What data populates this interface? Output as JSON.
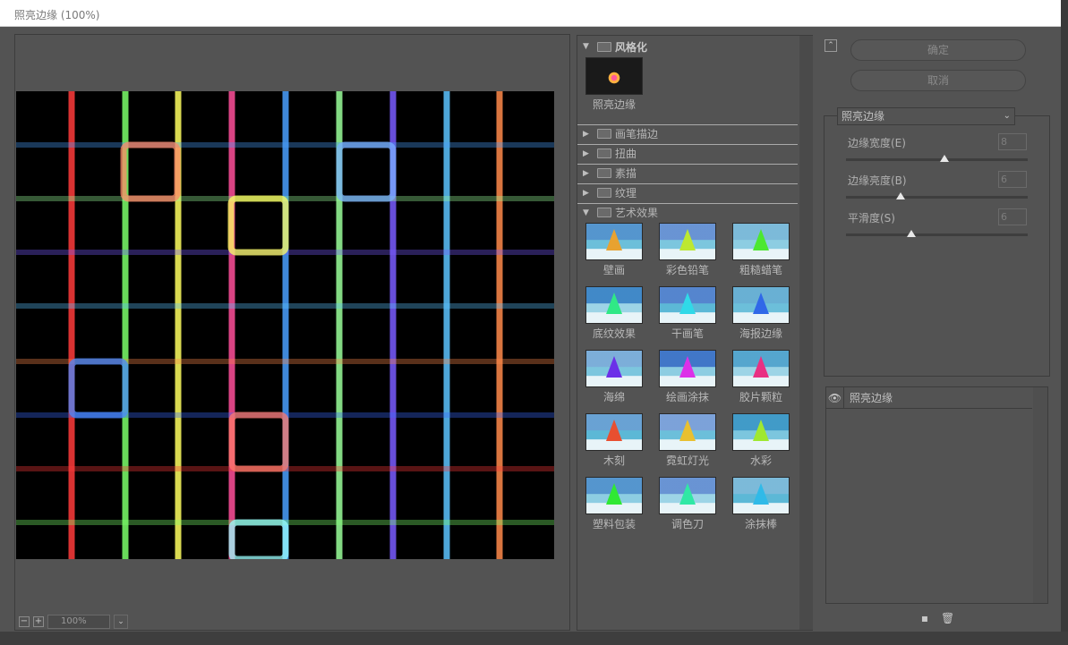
{
  "window": {
    "title": "照亮边缘 (100%)"
  },
  "preview": {
    "zoom_minus": "−",
    "zoom_plus": "+",
    "zoom_value": "100%",
    "zoom_dropdown": "⌄"
  },
  "gallery": {
    "categories": [
      {
        "label": "风格化",
        "open": true,
        "items": [
          {
            "label": "照亮边缘",
            "selected": true
          }
        ]
      },
      {
        "label": "画笔描边",
        "open": false
      },
      {
        "label": "扭曲",
        "open": false
      },
      {
        "label": "素描",
        "open": false
      },
      {
        "label": "纹理",
        "open": false
      },
      {
        "label": "艺术效果",
        "open": true,
        "items": [
          {
            "label": "壁画"
          },
          {
            "label": "彩色铅笔"
          },
          {
            "label": "粗糙蜡笔"
          },
          {
            "label": "底纹效果"
          },
          {
            "label": "干画笔"
          },
          {
            "label": "海报边缘"
          },
          {
            "label": "海绵"
          },
          {
            "label": "绘画涂抹"
          },
          {
            "label": "胶片颗粒"
          },
          {
            "label": "木刻"
          },
          {
            "label": "霓虹灯光"
          },
          {
            "label": "水彩"
          },
          {
            "label": "塑料包装"
          },
          {
            "label": "调色刀"
          },
          {
            "label": "涂抹棒"
          }
        ]
      }
    ],
    "expanded_icon": "▼",
    "collapsed_icon": "▶"
  },
  "actions": {
    "ok": "确定",
    "cancel": "取消"
  },
  "settings": {
    "filter_name": "照亮边缘",
    "params": [
      {
        "label": "边缘宽度(E)",
        "value": "8",
        "fraction": 0.54
      },
      {
        "label": "边缘亮度(B)",
        "value": "6",
        "fraction": 0.3
      },
      {
        "label": "平滑度(S)",
        "value": "6",
        "fraction": 0.36
      }
    ]
  },
  "layers": {
    "rows": [
      {
        "label": "照亮边缘",
        "visible": true
      }
    ]
  },
  "colors": {
    "panel": "#535353",
    "canvas": "#000000",
    "accent_lines": [
      "#ff3b3b",
      "#7cff6a",
      "#ffff60",
      "#ff4f9a",
      "#4aa0ff",
      "#9bff9b",
      "#7a5cff",
      "#5cc4ff",
      "#ff8a4a",
      "#3a6bff"
    ]
  }
}
